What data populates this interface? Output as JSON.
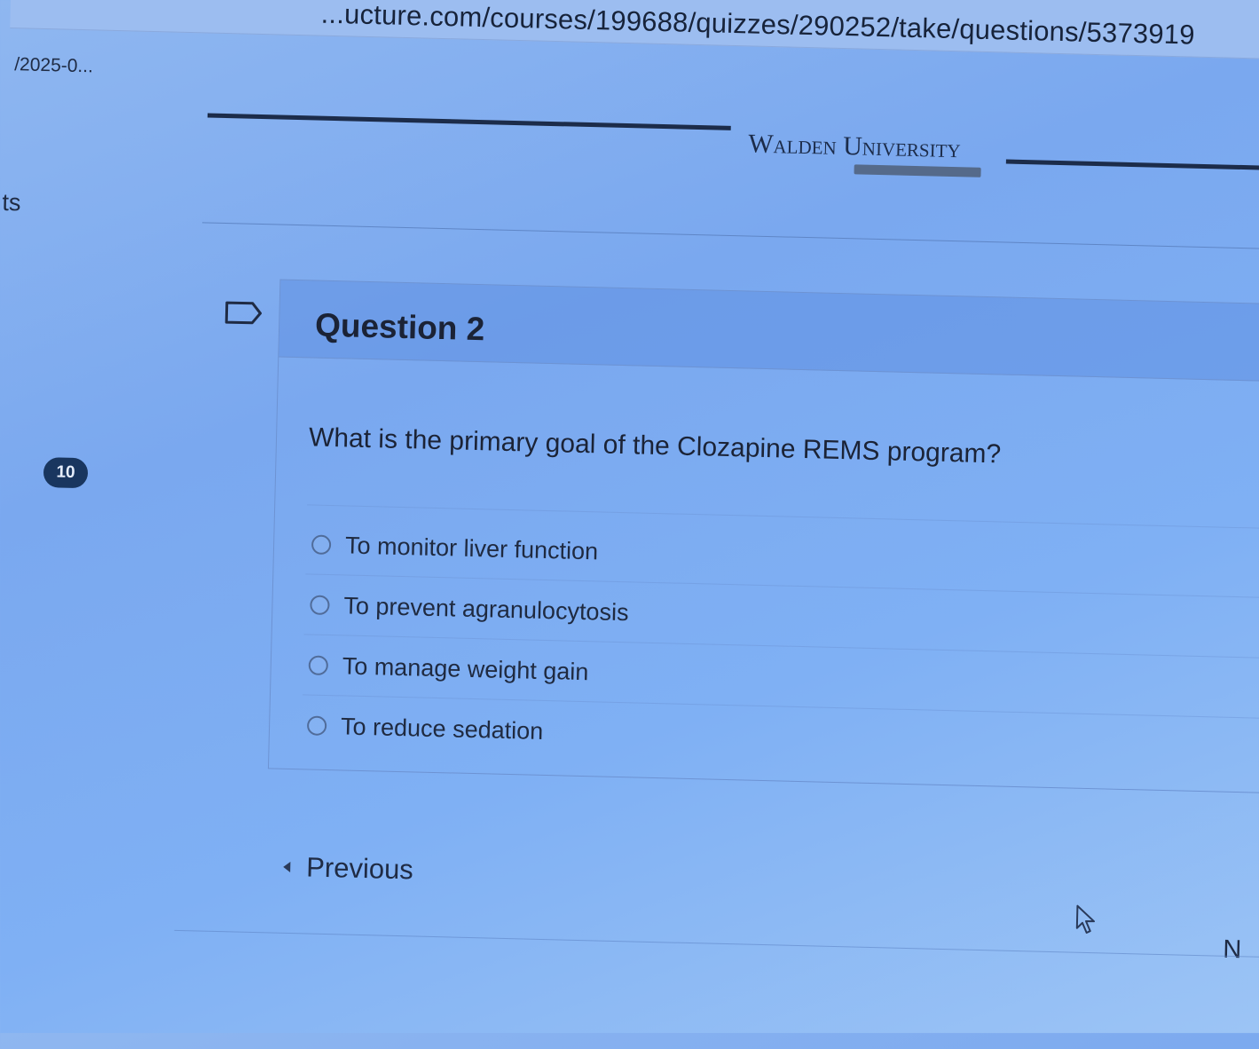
{
  "browser": {
    "url": "...ucture.com/courses/199688/quizzes/290252/take/questions/5373919"
  },
  "sidebar": {
    "breadcrumb": "/2025-0...",
    "partial_label": "ts",
    "question_count_badge": "10"
  },
  "header": {
    "logo_text": "Walden University"
  },
  "question": {
    "title": "Question 2",
    "text": "What is the primary goal of the Clozapine REMS program?",
    "options": [
      {
        "label": "To monitor liver function",
        "selected": false
      },
      {
        "label": "To prevent agranulocytosis",
        "selected": false
      },
      {
        "label": "To manage weight gain",
        "selected": false
      },
      {
        "label": "To reduce sedation",
        "selected": false
      }
    ]
  },
  "navigation": {
    "previous_label": "Previous",
    "next_partial": "N"
  },
  "colors": {
    "background": "#7aa8ef",
    "text": "#1b2336",
    "badge": "#19365f"
  }
}
